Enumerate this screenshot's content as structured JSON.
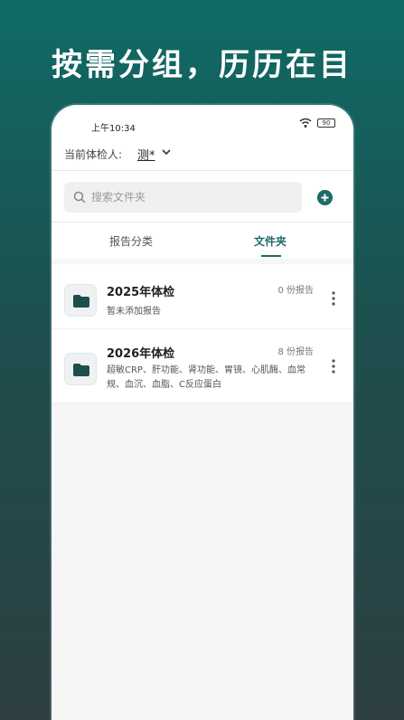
{
  "headline": "按需分组，历历在目",
  "status": {
    "time": "上午10:34",
    "battery": "90"
  },
  "header": {
    "person_label": "当前体检人:",
    "person_name": "测*"
  },
  "search": {
    "placeholder": "搜索文件夹"
  },
  "tabs": [
    {
      "label": "报告分类",
      "active": false
    },
    {
      "label": "文件夹",
      "active": true
    }
  ],
  "folders": [
    {
      "name": "2025年体检",
      "count": "0 份报告",
      "desc": "暂未添加报告"
    },
    {
      "name": "2026年体检",
      "count": "8 份报告",
      "desc": "超敏CRP、肝功能、肾功能、胃镜、心肌酶、血常规、血沉、血脂、C反应蛋白"
    }
  ],
  "colors": {
    "accent": "#1f6b68",
    "background_top": "#0f6b66"
  },
  "icons": [
    "wifi-icon",
    "battery-icon",
    "chevron-down-icon",
    "search-icon",
    "add-icon",
    "folder-icon",
    "more-icon"
  ]
}
